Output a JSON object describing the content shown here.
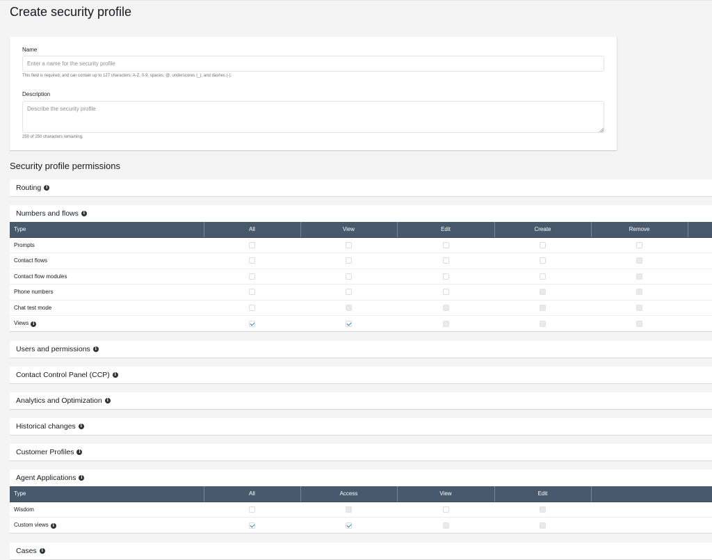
{
  "page": {
    "title": "Create security profile"
  },
  "form": {
    "name_label": "Name",
    "name_value": "",
    "name_placeholder": "Enter a name for the security profile",
    "name_hint": "This field is required, and can contain up to 127 characters: A-Z, 0-9, spaces, @, underscores (_), and dashes (-).",
    "description_label": "Description",
    "description_value": "",
    "description_placeholder": "Describe the security profile",
    "description_hint": "250 of 250 characters remaining."
  },
  "permissions": {
    "title": "Security profile permissions",
    "info_icon": "info-icon",
    "sections": {
      "routing": {
        "label": "Routing"
      },
      "numbers_and_flows": {
        "label": "Numbers and flows",
        "columns": [
          "Type",
          "All",
          "View",
          "Edit",
          "Create",
          "Remove"
        ],
        "rows": [
          {
            "type": "Prompts",
            "info": false,
            "states": [
              "unchecked",
              "unchecked",
              "unchecked",
              "unchecked",
              "unchecked"
            ]
          },
          {
            "type": "Contact flows",
            "info": false,
            "states": [
              "unchecked",
              "unchecked",
              "unchecked",
              "unchecked",
              "disabled"
            ]
          },
          {
            "type": "Contact flow modules",
            "info": false,
            "states": [
              "unchecked",
              "unchecked",
              "unchecked",
              "unchecked",
              "disabled"
            ]
          },
          {
            "type": "Phone numbers",
            "info": false,
            "states": [
              "unchecked",
              "unchecked",
              "unchecked",
              "disabled",
              "disabled"
            ]
          },
          {
            "type": "Chat test mode",
            "info": false,
            "states": [
              "unchecked",
              "disabled",
              "disabled",
              "disabled",
              "disabled"
            ]
          },
          {
            "type": "Views",
            "info": true,
            "states": [
              "checked",
              "checked",
              "disabled",
              "disabled",
              "disabled"
            ]
          }
        ]
      },
      "users_and_permissions": {
        "label": "Users and permissions"
      },
      "ccp": {
        "label": "Contact Control Panel (CCP)"
      },
      "analytics": {
        "label": "Analytics and Optimization"
      },
      "historical_changes": {
        "label": "Historical changes"
      },
      "customer_profiles": {
        "label": "Customer Profiles"
      },
      "agent_applications": {
        "label": "Agent Applications",
        "columns": [
          "Type",
          "All",
          "Access",
          "View",
          "Edit"
        ],
        "rows": [
          {
            "type": "Wisdom",
            "info": false,
            "states": [
              "unchecked",
              "disabled",
              "unchecked",
              "disabled"
            ]
          },
          {
            "type": "Custom views",
            "info": true,
            "states": [
              "checked",
              "checked",
              "disabled",
              "disabled"
            ]
          }
        ]
      },
      "cases": {
        "label": "Cases"
      }
    }
  },
  "colors": {
    "table_header_bg": "#48596e",
    "checkmark": "#2d7fb5",
    "page_bg": "#f4f4f4"
  }
}
